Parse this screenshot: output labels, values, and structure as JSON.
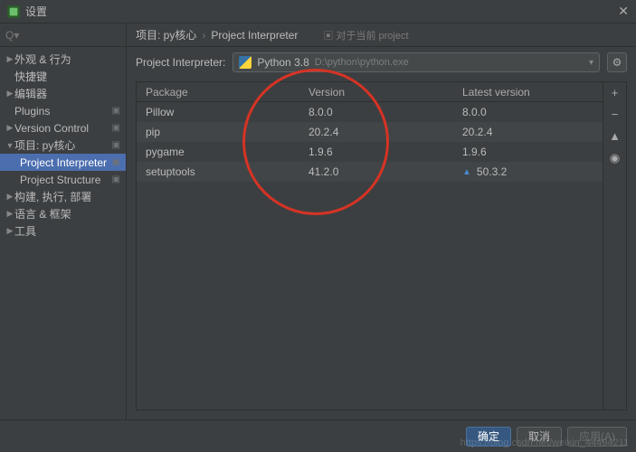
{
  "window": {
    "title": "设置"
  },
  "search": {
    "placeholder": "Q▾"
  },
  "sidebar": {
    "items": [
      {
        "label": "外观 & 行为",
        "expandable": true,
        "expanded": false
      },
      {
        "label": "快捷键",
        "expandable": false
      },
      {
        "label": "编辑器",
        "expandable": true,
        "expanded": false
      },
      {
        "label": "Plugins",
        "expandable": false,
        "tagged": true
      },
      {
        "label": "Version Control",
        "expandable": true,
        "expanded": false,
        "tagged": true
      },
      {
        "label": "项目: py核心",
        "expandable": true,
        "expanded": true,
        "tagged": true,
        "children": [
          {
            "label": "Project Interpreter",
            "selected": true,
            "tagged": true
          },
          {
            "label": "Project Structure",
            "tagged": true
          }
        ]
      },
      {
        "label": "构建, 执行, 部署",
        "expandable": true,
        "expanded": false
      },
      {
        "label": "语言 & 框架",
        "expandable": true,
        "expanded": false
      },
      {
        "label": "工具",
        "expandable": true,
        "expanded": false
      }
    ]
  },
  "breadcrumb": {
    "root": "项目: py核心",
    "leaf": "Project Interpreter",
    "note_icon": "▣",
    "note": "对于当前 project"
  },
  "interpreter": {
    "label": "Project Interpreter:",
    "name": "Python 3.8",
    "path": "D:\\python\\python.exe"
  },
  "packages": {
    "columns": {
      "package": "Package",
      "version": "Version",
      "latest": "Latest version"
    },
    "rows": [
      {
        "name": "Pillow",
        "version": "8.0.0",
        "latest": "8.0.0",
        "upgrade": false
      },
      {
        "name": "pip",
        "version": "20.2.4",
        "latest": "20.2.4",
        "upgrade": false
      },
      {
        "name": "pygame",
        "version": "1.9.6",
        "latest": "1.9.6",
        "upgrade": false
      },
      {
        "name": "setuptools",
        "version": "41.2.0",
        "latest": "50.3.2",
        "upgrade": true
      }
    ],
    "actions": {
      "add": "+",
      "remove": "−",
      "upgrade": "▲",
      "eye": "◉"
    }
  },
  "footer": {
    "ok": "确定",
    "cancel": "取消",
    "apply": "应用(A)"
  },
  "watermark": "https://blog.csdn.net/weixin_44494211"
}
